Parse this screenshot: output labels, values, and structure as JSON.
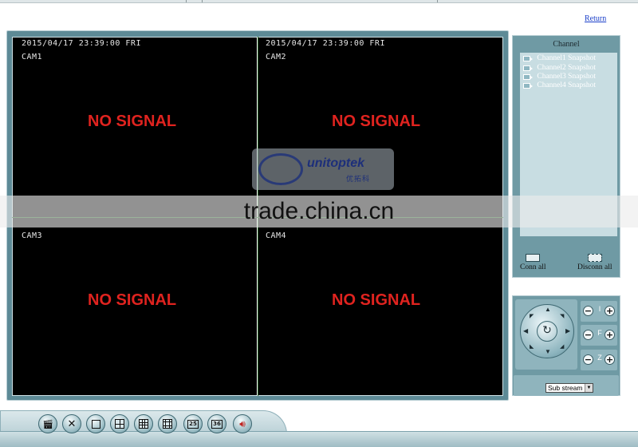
{
  "header": {
    "return_link": "Return"
  },
  "video": {
    "cells": [
      {
        "timestamp": "2015/04/17 23:39:00 FRI",
        "camera": "CAM1",
        "status": "NO SIGNAL"
      },
      {
        "timestamp": "2015/04/17 23:39:00 FRI",
        "camera": "CAM2",
        "status": "NO SIGNAL"
      },
      {
        "camera": "CAM3",
        "status": "NO SIGNAL"
      },
      {
        "camera": "CAM4",
        "status": "NO SIGNAL"
      }
    ]
  },
  "channel_panel": {
    "title": "Channel",
    "items": [
      "Channel1 Snapshot",
      "Channel2 Snapshot",
      "Channel3 Snapshot",
      "Channel4 Snapshot"
    ],
    "connect_all": "Conn all",
    "disconnect_all": "Disconn all"
  },
  "ptz": {
    "iris_label": "I",
    "focus_label": "F",
    "zoom_label": "Z",
    "stream_select": {
      "selected": "Sub stream"
    }
  },
  "toolbar": {
    "layout_25_label": "25",
    "layout_36_label": "36"
  },
  "overlays": {
    "watermark": "trade.china.cn",
    "logo_text": "unitoptek",
    "logo_subtext": "优拓科"
  },
  "colors": {
    "frame": "#5d8a96",
    "panel": "#6f9aa4",
    "no_signal": "#e0231f",
    "link": "#1a3fc9"
  },
  "icons": {
    "record": "record-icon",
    "settings": "tools-icon",
    "layout_1": "single-view-icon",
    "layout_4": "quad-view-icon",
    "layout_9": "nine-view-icon",
    "layout_16": "sixteen-view-icon",
    "audio": "speaker-icon"
  }
}
